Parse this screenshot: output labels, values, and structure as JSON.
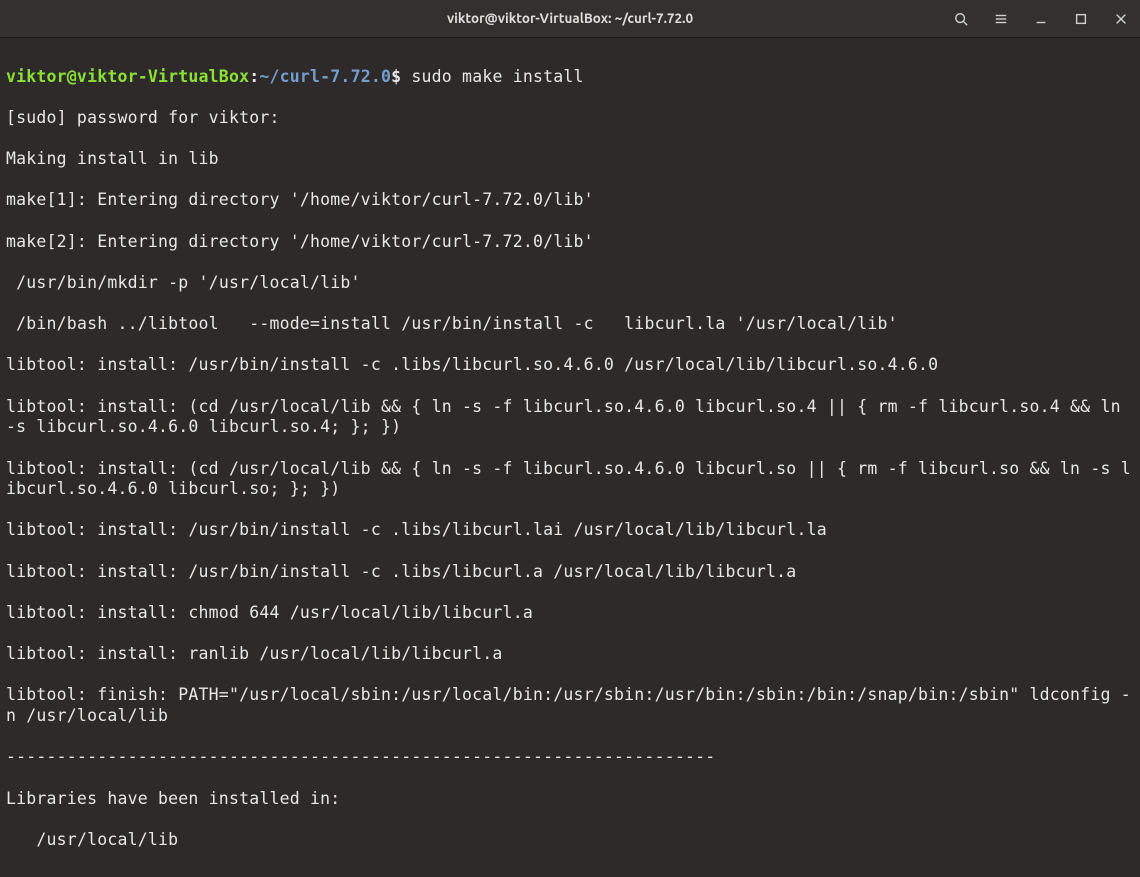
{
  "titlebar": {
    "title": "viktor@viktor-VirtualBox: ~/curl-7.72.0"
  },
  "prompt": {
    "user_host": "viktor@viktor-VirtualBox",
    "colon": ":",
    "path": "~/curl-7.72.0",
    "symbol": "$"
  },
  "command": "sudo make install",
  "output": {
    "l0": "[sudo] password for viktor:",
    "l1": "Making install in lib",
    "l2": "make[1]: Entering directory '/home/viktor/curl-7.72.0/lib'",
    "l3": "make[2]: Entering directory '/home/viktor/curl-7.72.0/lib'",
    "l4": " /usr/bin/mkdir -p '/usr/local/lib'",
    "l5": " /bin/bash ../libtool   --mode=install /usr/bin/install -c   libcurl.la '/usr/local/lib'",
    "l6": "libtool: install: /usr/bin/install -c .libs/libcurl.so.4.6.0 /usr/local/lib/libcurl.so.4.6.0",
    "l7": "libtool: install: (cd /usr/local/lib && { ln -s -f libcurl.so.4.6.0 libcurl.so.4 || { rm -f libcurl.so.4 && ln -s libcurl.so.4.6.0 libcurl.so.4; }; })",
    "l8": "libtool: install: (cd /usr/local/lib && { ln -s -f libcurl.so.4.6.0 libcurl.so || { rm -f libcurl.so && ln -s libcurl.so.4.6.0 libcurl.so; }; })",
    "l9": "libtool: install: /usr/bin/install -c .libs/libcurl.lai /usr/local/lib/libcurl.la",
    "l10": "libtool: install: /usr/bin/install -c .libs/libcurl.a /usr/local/lib/libcurl.a",
    "l11": "libtool: install: chmod 644 /usr/local/lib/libcurl.a",
    "l12": "libtool: install: ranlib /usr/local/lib/libcurl.a",
    "l13": "libtool: finish: PATH=\"/usr/local/sbin:/usr/local/bin:/usr/sbin:/usr/bin:/sbin:/bin:/snap/bin:/sbin\" ldconfig -n /usr/local/lib",
    "divider": "----------------------------------------------------------------------",
    "l14": "Libraries have been installed in:",
    "l15": "   /usr/local/lib"
  }
}
